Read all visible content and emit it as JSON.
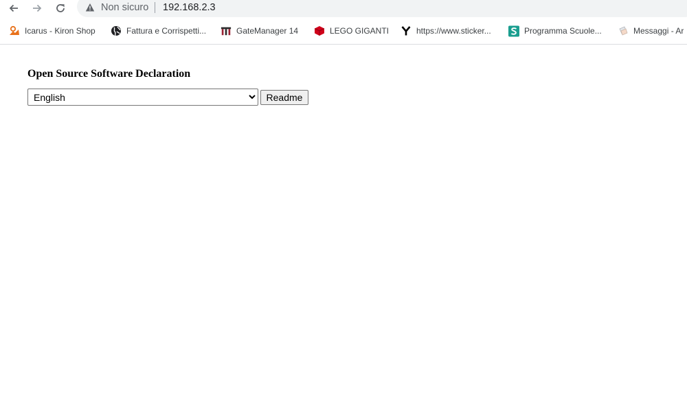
{
  "browser": {
    "security_status": "Non sicuro",
    "url": "192.168.2.3",
    "icons": {
      "back": "back-arrow-icon",
      "forward": "forward-arrow-icon",
      "reload": "reload-icon",
      "warning": "warning-triangle-icon"
    }
  },
  "bookmarks": [
    {
      "label": "Icarus - Kiron Shop",
      "icon": "kiron-icon",
      "color": "#e8711a"
    },
    {
      "label": "Fattura e Corrispetti...",
      "icon": "globe-icon",
      "color": "#202124"
    },
    {
      "label": "GateManager 14",
      "icon": "gatemanager-icon",
      "color": "#9b2335"
    },
    {
      "label": "LEGO GIGANTI",
      "icon": "lego-brick-icon",
      "color": "#d0021b"
    },
    {
      "label": "https://www.sticker...",
      "icon": "y-letter-icon",
      "color": "#000000"
    },
    {
      "label": "Programma Scuole...",
      "icon": "s-badge-icon",
      "color": "#1a9e8f"
    },
    {
      "label": "Messaggi - Ar",
      "icon": "messages-icon",
      "color": "#9aa0a6"
    }
  ],
  "page": {
    "title": "Open Source Software Declaration",
    "language_selected": "English",
    "readme_label": "Readme"
  }
}
